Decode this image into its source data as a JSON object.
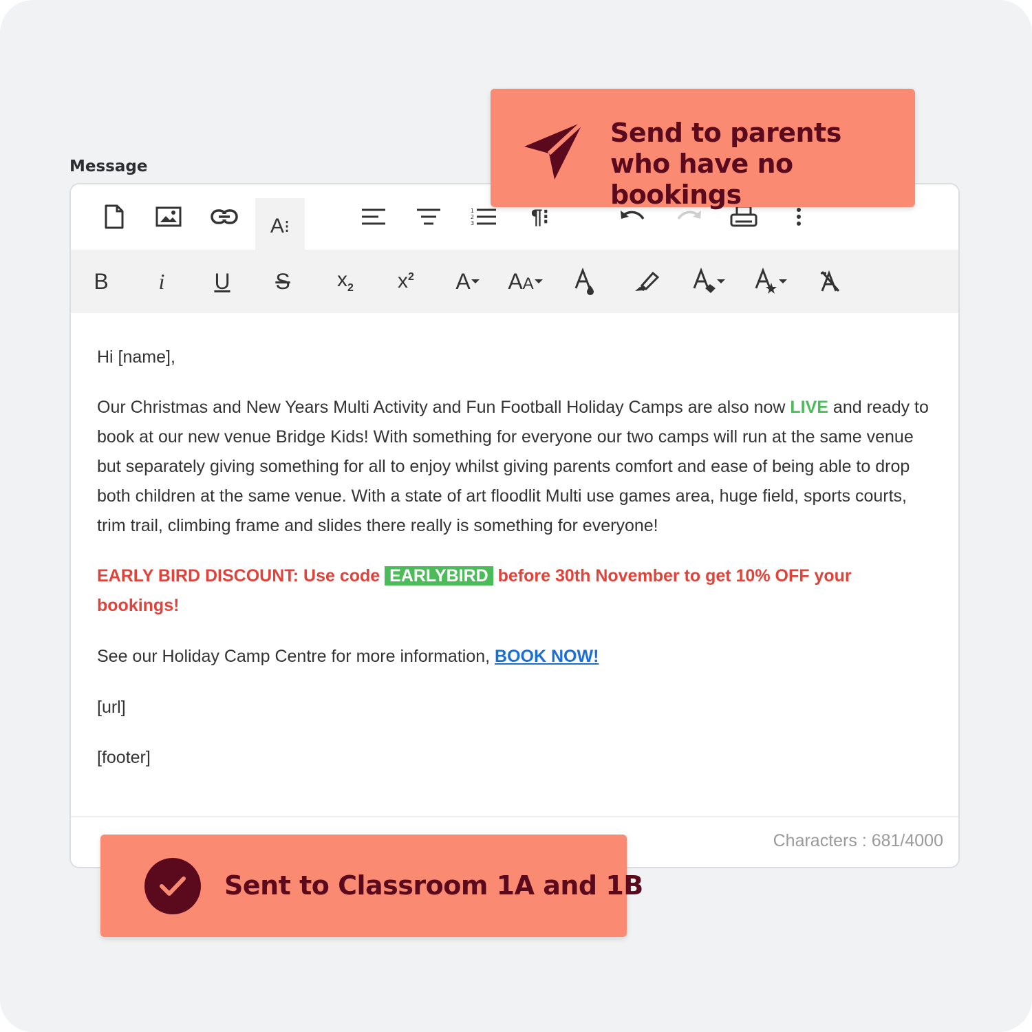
{
  "field_label": "Message",
  "toolbar_top": [
    "file-icon",
    "image-icon",
    "link-icon",
    "text-styles-icon",
    "align-left-icon",
    "align-center-icon",
    "ordered-list-icon",
    "paragraph-format-icon",
    "undo-icon",
    "redo-icon",
    "print-icon",
    "more-icon"
  ],
  "toolbar_format": {
    "bold": "B",
    "italic": "i",
    "underline": "U",
    "strikethrough": "S",
    "subscript": "x",
    "subscript_sub": "2",
    "superscript": "x",
    "superscript_sup": "2",
    "font_family": "A",
    "font_size_big": "A",
    "font_size_small": "A",
    "text_color": "A",
    "bg_color": "A",
    "inline_style": "A",
    "clear_format": "A"
  },
  "message": {
    "greeting": "Hi [name],",
    "p2_before": "Our Christmas and New Years Multi Activity and Fun Football Holiday Camps are also now ",
    "p2_live": "LIVE",
    "p2_after": " and ready to book at our new venue Bridge Kids! With something for everyone our two camps will run at the same venue but separately giving something for all to enjoy whilst giving parents comfort and ease of being able to drop both children at the same venue. With a state of art floodlit Multi use games area, huge field, sports courts, trim trail, climbing frame and slides there really is something for everyone!",
    "discount_before": "EARLY BIRD DISCOUNT: Use code ",
    "discount_code": "EARLYBIRD",
    "discount_after": " before 30th November to get 10% OFF your bookings!",
    "info_text": "See our Holiday Camp Centre for more information, ",
    "book_link": "BOOK NOW!",
    "url_placeholder": "[url]",
    "footer_placeholder": "[footer]"
  },
  "character_count": "Characters : 681/4000",
  "callout_send": "Send to parents who have no bookings",
  "callout_sent": "Sent to Classroom 1A and 1B",
  "colors": {
    "callout_bg": "#fb8a73",
    "callout_text": "#5a0a1c",
    "discount_red": "#e0433a",
    "live_green": "#4cbb5a",
    "link_blue": "#1a6fd6"
  }
}
